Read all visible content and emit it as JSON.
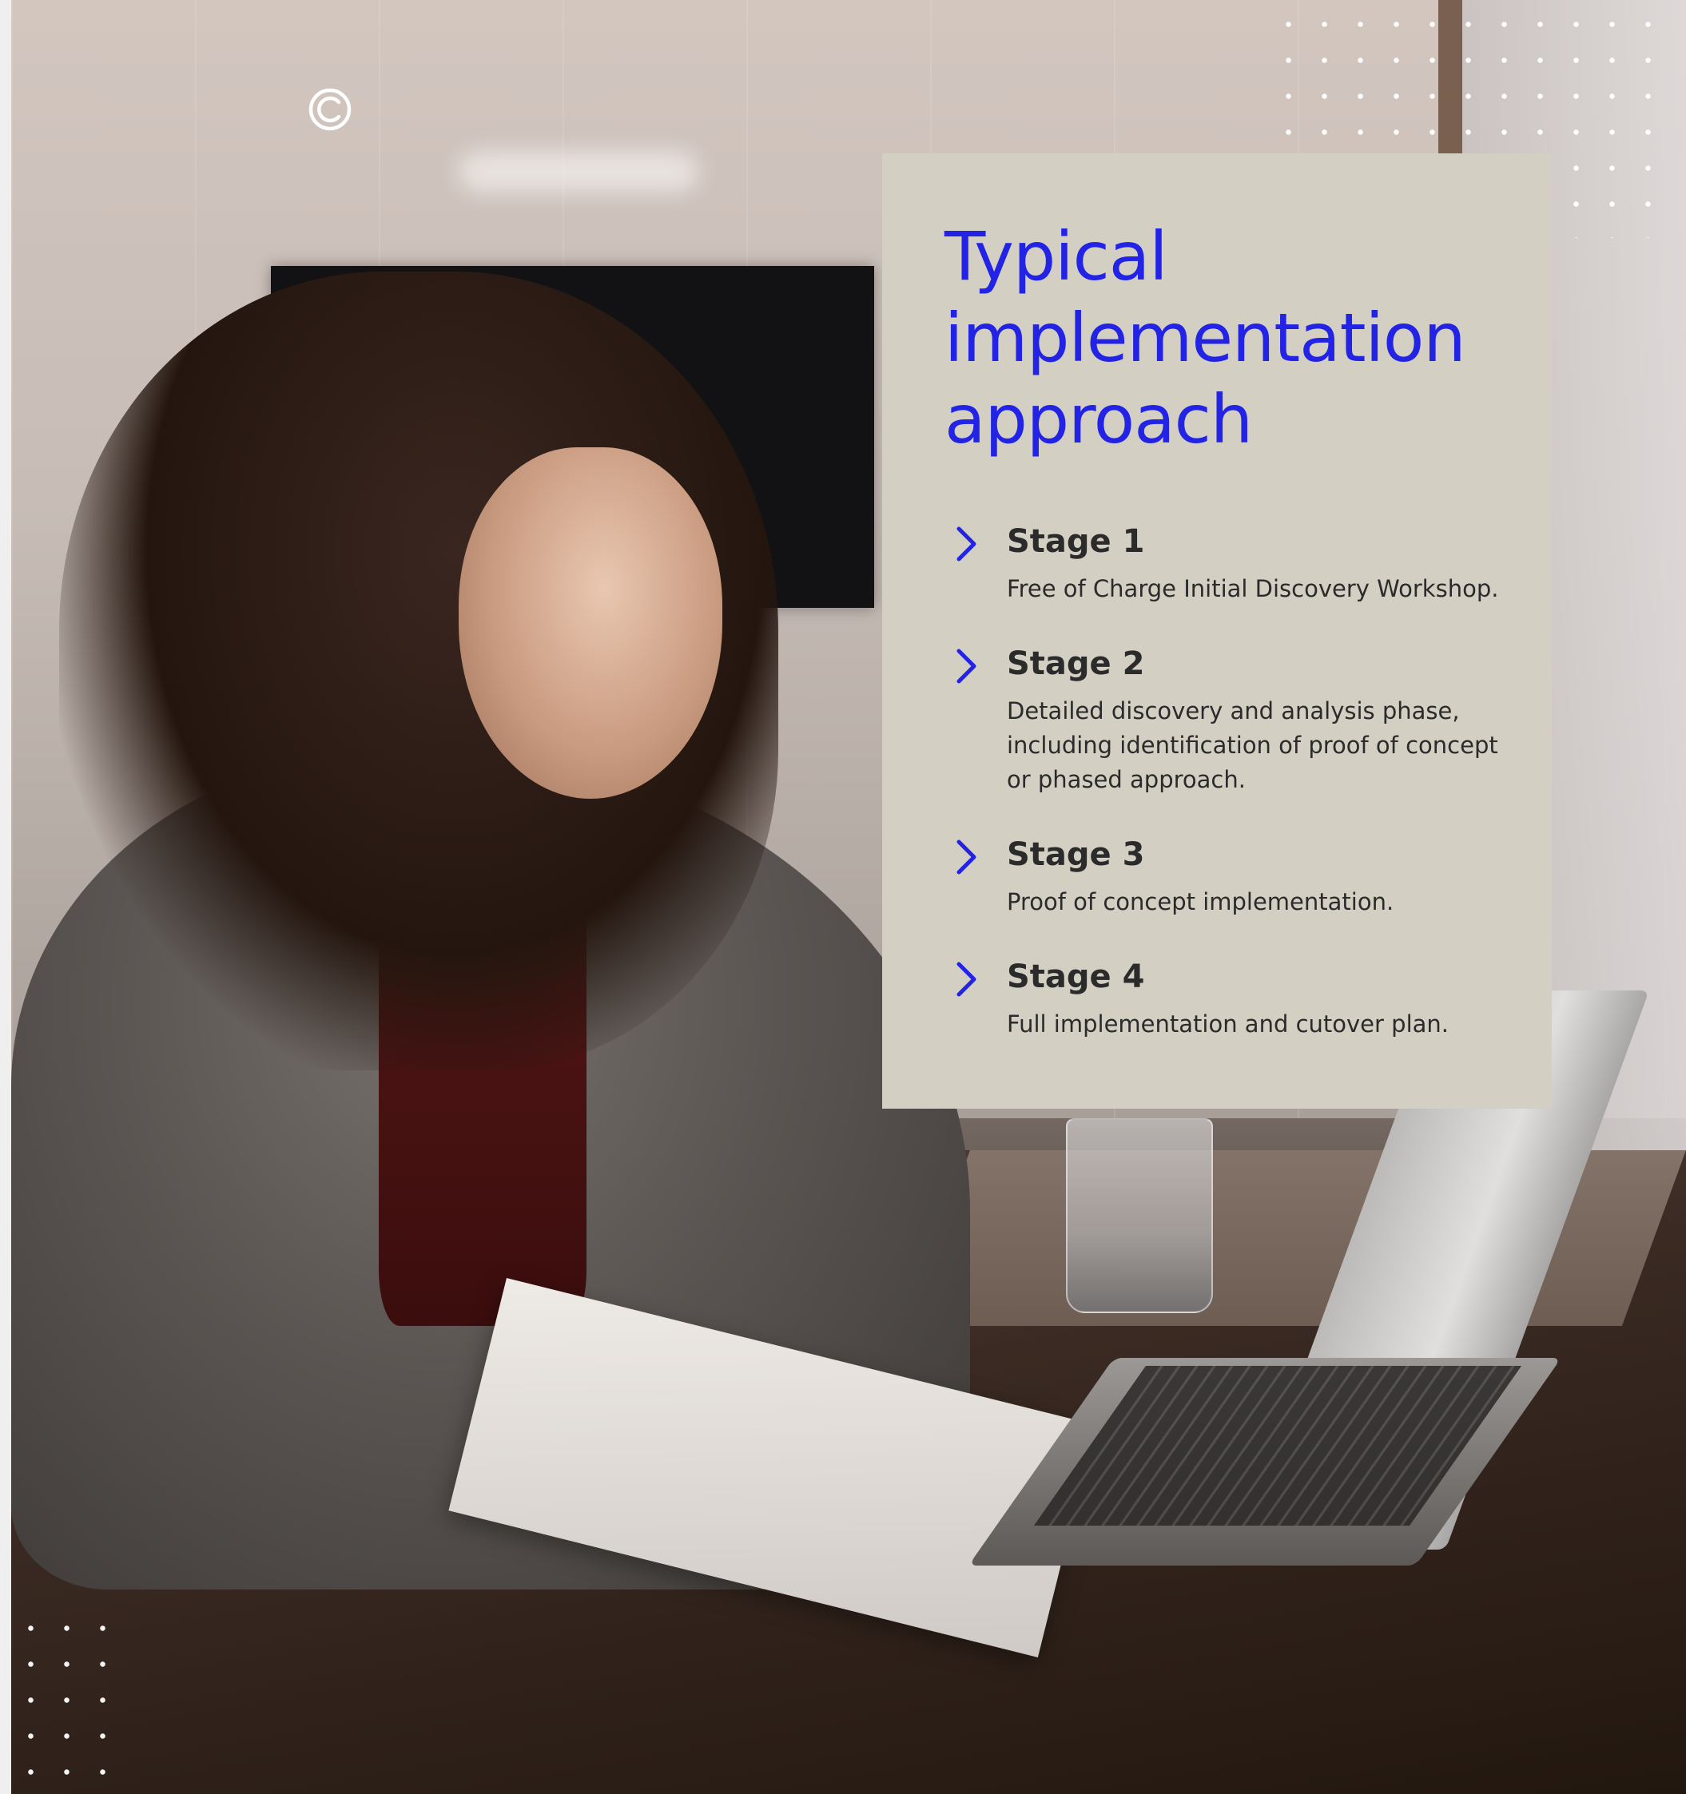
{
  "page": {
    "title_lines": [
      "Typical",
      "implementation",
      "approach"
    ],
    "accent_color": "#2323e5",
    "card_color": "#d3cfc3",
    "text_color": "#2b2b2b"
  },
  "logo": {
    "icon": "circle-logo-icon"
  },
  "stages": [
    {
      "name": "Stage 1",
      "description": "Free of Charge Initial Discovery Workshop.",
      "icon": "chevron-right-icon"
    },
    {
      "name": "Stage 2",
      "description": "Detailed discovery and analysis phase, including identification of proof of concept or phased approach.",
      "icon": "chevron-right-icon"
    },
    {
      "name": "Stage 3",
      "description": "Proof of concept implementation.",
      "icon": "chevron-right-icon"
    },
    {
      "name": "Stage 4",
      "description": "Full implementation and cutover plan.",
      "icon": "chevron-right-icon"
    }
  ]
}
